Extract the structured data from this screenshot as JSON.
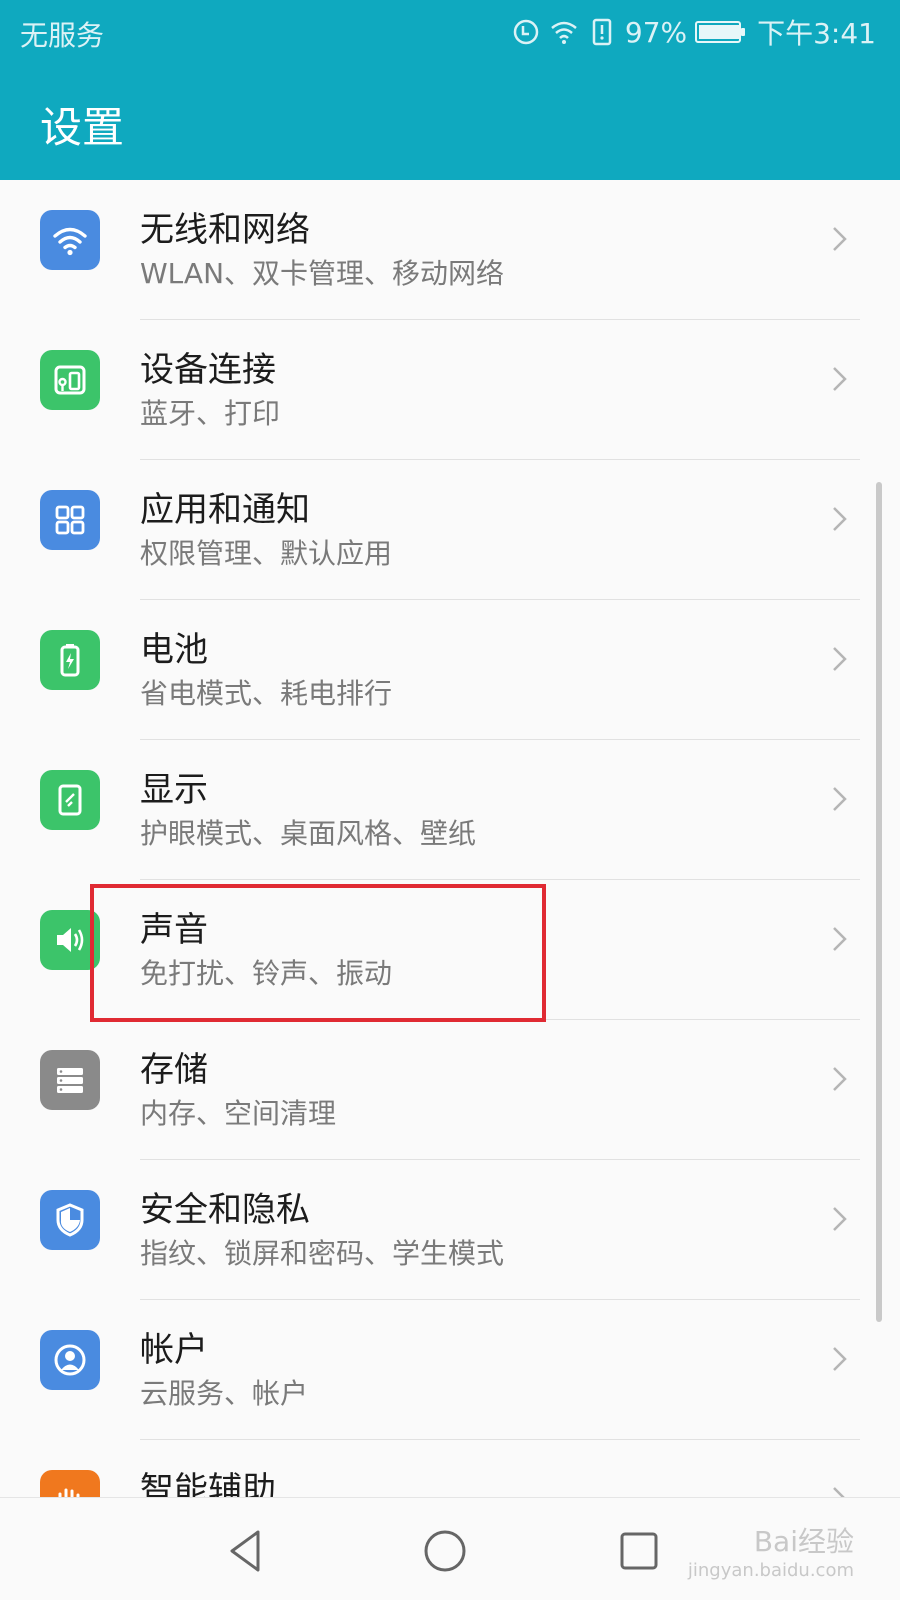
{
  "status_bar": {
    "carrier": "无服务",
    "battery": "97%",
    "time": "下午3:41"
  },
  "header": {
    "title": "设置"
  },
  "settings": [
    {
      "title": "无线和网络",
      "subtitle": "WLAN、双卡管理、移动网络",
      "icon": "wifi-icon",
      "color": "#4a8be0"
    },
    {
      "title": "设备连接",
      "subtitle": "蓝牙、打印",
      "icon": "device-connection-icon",
      "color": "#3cc46a"
    },
    {
      "title": "应用和通知",
      "subtitle": "权限管理、默认应用",
      "icon": "apps-grid-icon",
      "color": "#4a8be0"
    },
    {
      "title": "电池",
      "subtitle": "省电模式、耗电排行",
      "icon": "battery-icon",
      "color": "#3cc46a"
    },
    {
      "title": "显示",
      "subtitle": "护眼模式、桌面风格、壁纸",
      "icon": "display-icon",
      "color": "#3cc46a"
    },
    {
      "title": "声音",
      "subtitle": "免打扰、铃声、振动",
      "icon": "speaker-icon",
      "color": "#3cc46a"
    },
    {
      "title": "存储",
      "subtitle": "内存、空间清理",
      "icon": "storage-icon",
      "color": "#8a8a8a"
    },
    {
      "title": "安全和隐私",
      "subtitle": "指纹、锁屏和密码、学生模式",
      "icon": "shield-icon",
      "color": "#4a8be0"
    },
    {
      "title": "帐户",
      "subtitle": "云服务、帐户",
      "icon": "account-icon",
      "color": "#4a8be0"
    },
    {
      "title": "智能辅助",
      "subtitle": "",
      "icon": "smart-assist-icon",
      "color": "#f0781e"
    }
  ],
  "watermark": {
    "brand": "Bai经验",
    "url": "jingyan.baidu.com"
  },
  "colors": {
    "accent": "#0fa9bf",
    "highlight": "#e02a33"
  }
}
